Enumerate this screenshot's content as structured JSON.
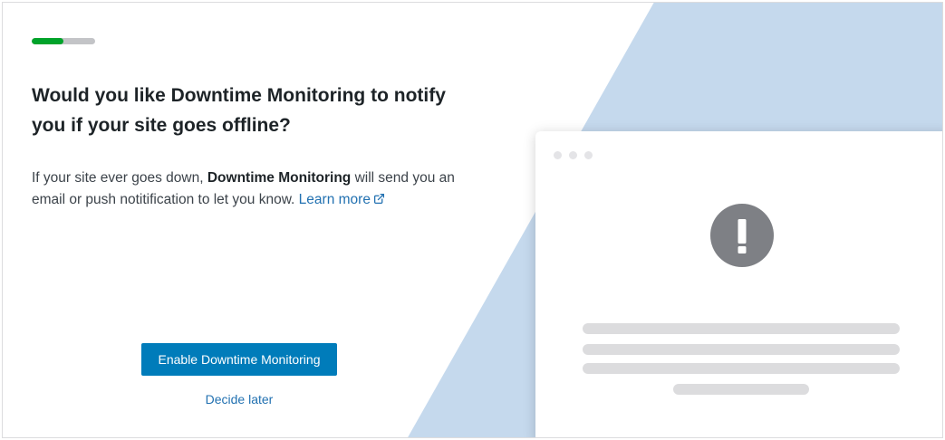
{
  "onboarding": {
    "progress_fraction": 0.5,
    "progress_color": "#00a32a",
    "heading": "Would you like Downtime Monitoring to notify you if your site goes offline?",
    "description": {
      "prefix": "If your site ever goes down, ",
      "strong": "Downtime Monitoring",
      "suffix": " will send you an email or push notitification to let you know. ",
      "link_label": "Learn more",
      "link_icon": "external-link-icon"
    },
    "primary_button": "Enable Downtime Monitoring",
    "secondary_link": "Decide later",
    "accent_color": "#007cba"
  },
  "illustration": {
    "background_color": "#c5d9ed",
    "alert_icon": "exclamation-circle-icon",
    "alert_color": "#7e8085"
  }
}
